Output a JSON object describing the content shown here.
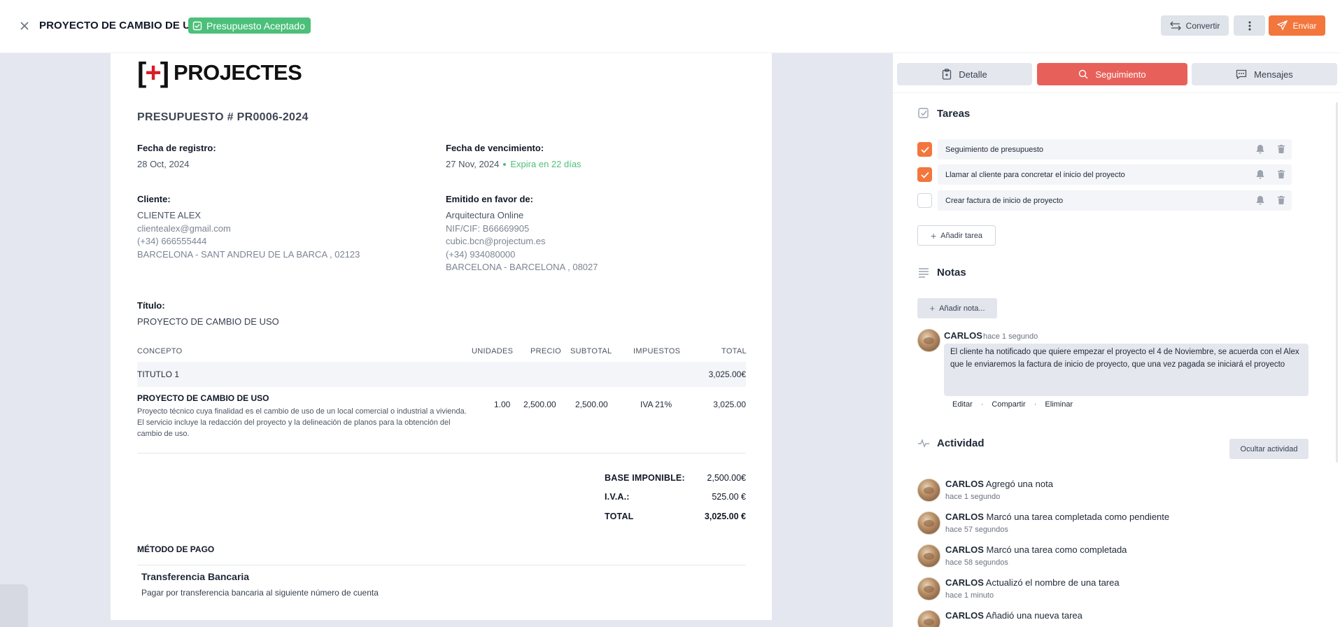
{
  "header": {
    "title": "PROYECTO DE CAMBIO DE USO",
    "status_badge": "Presupuesto Aceptado",
    "convert_label": "Convertir",
    "send_label": "Enviar"
  },
  "document": {
    "logo_mark_left": "[",
    "logo_mark_plus": "+",
    "logo_mark_right": "]",
    "logo_text": "PROJECTES",
    "number": "PRESUPUESTO # PR0006-2024",
    "registro_label": "Fecha de registro:",
    "registro_value": "28 Oct, 2024",
    "vencimiento_label": "Fecha de vencimiento:",
    "vencimiento_value": "27 Nov, 2024",
    "expira": "Expira en 22 días",
    "cliente_label": "Cliente:",
    "cliente": {
      "name": "CLIENTE ALEX",
      "email": "clientealex@gmail.com",
      "phone": "(+34) 666555444",
      "address": "BARCELONA - SANT ANDREU DE LA BARCA , 02123"
    },
    "emitido_label": "Emitido en favor de:",
    "emisor": {
      "name": "Arquitectura Online",
      "nif": "NIF/CIF: B66669905",
      "email": "cubic.bcn@projectum.es",
      "phone": "(+34) 934080000",
      "address": "BARCELONA - BARCELONA , 08027"
    },
    "titulo_label": "Título:",
    "titulo_value": "PROYECTO DE CAMBIO DE USO",
    "table": {
      "headers": [
        "CONCEPTO",
        "UNIDADES",
        "PRECIO",
        "SUBTOTAL",
        "IMPUESTOS",
        "TOTAL"
      ],
      "section_title": "TITUTLO 1",
      "section_total": "3,025.00€",
      "line": {
        "concept": "PROYECTO DE CAMBIO DE USO",
        "description": "Proyecto técnico cuya finalidad es el cambio de uso de un local comercial o industrial a vivienda. El servicio incluye la redacción del proyecto y la delineación de planos para la obtención del cambio de uso.",
        "units": "1.00",
        "price": "2,500.00",
        "subtotal": "2,500.00",
        "tax": "IVA 21%",
        "total": "3,025.00"
      }
    },
    "totals": {
      "base_label": "BASE IMPONIBLE:",
      "base_value": "2,500.00€",
      "iva_label": "I.V.A.:",
      "iva_value": "525.00 €",
      "total_label": "TOTAL",
      "total_value": "3,025.00 €"
    },
    "payment": {
      "title": "MÉTODO DE PAGO",
      "name": "Transferencia Bancaria",
      "description": "Pagar por transferencia bancaria al siguiente número de cuenta"
    }
  },
  "panel": {
    "tabs": [
      {
        "label": "Detalle",
        "active": false
      },
      {
        "label": "Seguimiento",
        "active": true
      },
      {
        "label": "Mensajes",
        "active": false
      }
    ],
    "tasks_title": "Tareas",
    "tasks": [
      {
        "label": "Seguimiento de presupuesto",
        "done": true
      },
      {
        "label": "Llamar al cliente para concretar el inicio del proyecto",
        "done": true
      },
      {
        "label": "Crear factura de inicio de proyecto",
        "done": false
      }
    ],
    "add_task_label": "Añadir tarea",
    "notes_title": "Notas",
    "add_note_label": "Añadir nota...",
    "note": {
      "author": "CARLOS",
      "time": "hace 1 segundo",
      "text": "El cliente ha notificado que quiere empezar el proyecto el 4 de Noviembre, se acuerda con el Alex que le enviaremos la factura de inicio de proyecto, que una vez pagada se iniciará el proyecto",
      "actions": [
        "Editar",
        "Compartir",
        "Eliminar"
      ]
    },
    "activity_title": "Actividad",
    "hide_activity_label": "Ocultar actividad",
    "activity": [
      {
        "author": "CARLOS",
        "action": "Agregó una nota",
        "time": "hace 1 segundo"
      },
      {
        "author": "CARLOS",
        "action": "Marcó una tarea completada como pendiente",
        "time": "hace 57 segundos"
      },
      {
        "author": "CARLOS",
        "action": "Marcó una tarea como completada",
        "time": "hace 58 segundos"
      },
      {
        "author": "CARLOS",
        "action": "Actualizó el nombre de una tarea",
        "time": "hace 1 minuto"
      },
      {
        "author": "CARLOS",
        "action": "Añadió una nueva tarea",
        "time": ""
      }
    ]
  },
  "colors": {
    "accent": "#f3763d",
    "active_tab": "#e8605a",
    "success": "#4cc07a",
    "logo_red": "#d91c25"
  }
}
